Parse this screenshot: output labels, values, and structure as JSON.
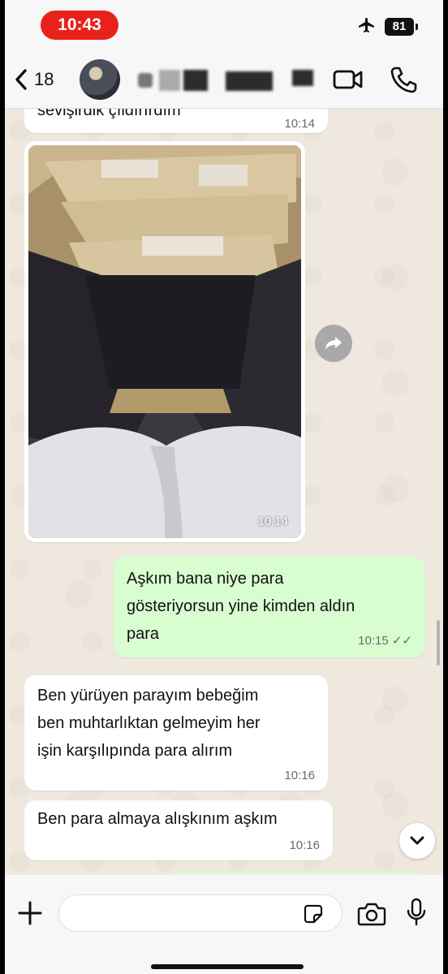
{
  "status": {
    "time": "10:43",
    "battery": "81"
  },
  "header": {
    "back_count": "18"
  },
  "messages": {
    "m0": {
      "text": "sevişirdik çıldırırdım",
      "time": "10:14"
    },
    "media": {
      "time": "10:14"
    },
    "m1": {
      "line1": "Aşkım bana niye para",
      "line2": "gösteriyorsun yine kimden aldın",
      "line3": "para",
      "time": "10:15 ✓✓"
    },
    "m2": {
      "line1": "Ben yürüyen parayım bebeğim",
      "line2": "ben muhtarlıktan gelmeyim her",
      "line3": "işin karşılıpında para alırım",
      "time": "10:16"
    },
    "m3": {
      "text": "Ben para almaya alışkınım aşkım",
      "time": "10:16"
    }
  },
  "input": {
    "placeholder": ""
  },
  "colors": {
    "incoming": "#ffffff",
    "outgoing": "#d8fdd1",
    "time_pill": "#e8221a",
    "chat_bg": "#efe8de"
  },
  "icons": [
    "airplane-icon",
    "back-chevron-icon",
    "video-call-icon",
    "phone-icon",
    "forward-icon",
    "chevron-down-icon",
    "plus-icon",
    "sticker-icon",
    "camera-icon",
    "mic-icon"
  ]
}
